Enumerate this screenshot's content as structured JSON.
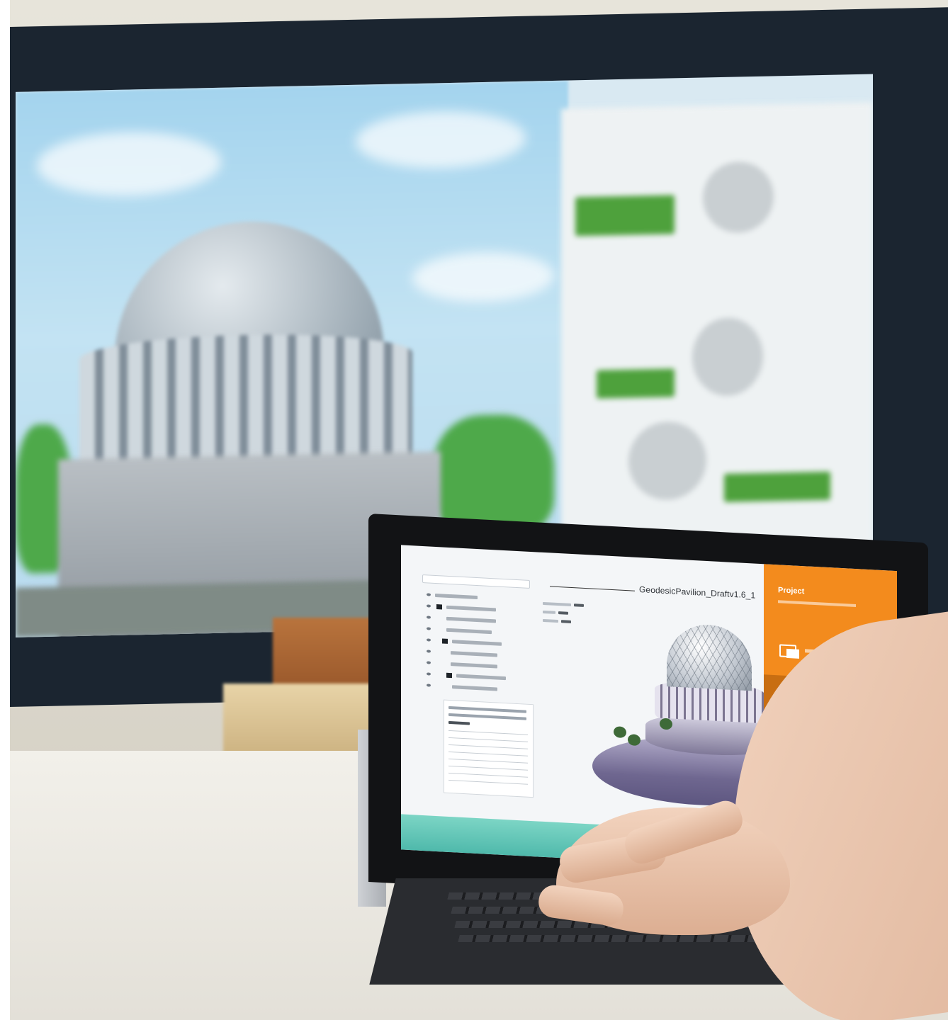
{
  "laptop_screen": {
    "document_title": "GeodesicPavilion_Draftv1.6_1",
    "sidebar_title": "Project"
  },
  "colors": {
    "sidebar_accent": "#f38b1d",
    "sidebar_active": "#c86e12",
    "footer_band": "#5cc2b3",
    "tv_sky": "#a4d4ee",
    "tv_green": "#4ea13c"
  }
}
